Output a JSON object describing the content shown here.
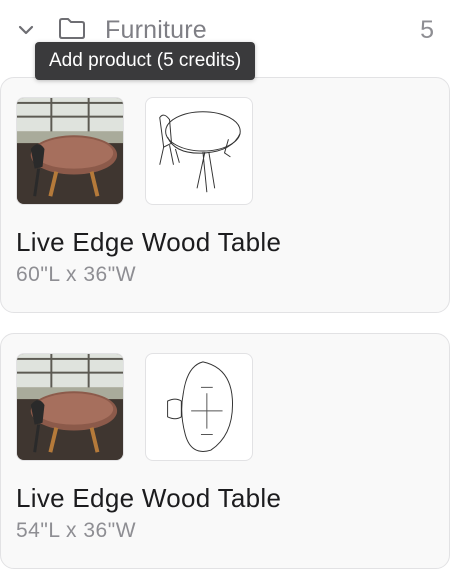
{
  "category": {
    "chevron_icon": "chevron-down-icon",
    "folder_icon": "folder-icon",
    "title": "Furniture",
    "count": "5"
  },
  "tooltip": {
    "text": "Add product (5 credits)"
  },
  "products": [
    {
      "name": "Live Edge Wood Table",
      "dimensions": "60\"L x 36\"W",
      "photo_icon": "table-photo-thumbnail",
      "drawing_icon": "table-line-drawing-thumbnail"
    },
    {
      "name": "Live Edge Wood Table",
      "dimensions": "54\"L x 36\"W",
      "photo_icon": "table-photo-thumbnail",
      "drawing_icon": "table-plan-drawing-thumbnail"
    }
  ],
  "colors": {
    "card_background": "#f9f9f9",
    "card_border": "#e2e2e4",
    "tooltip_background": "#3a3a3c",
    "title_text": "#1c1c1e",
    "secondary_text": "#8e8e93"
  }
}
